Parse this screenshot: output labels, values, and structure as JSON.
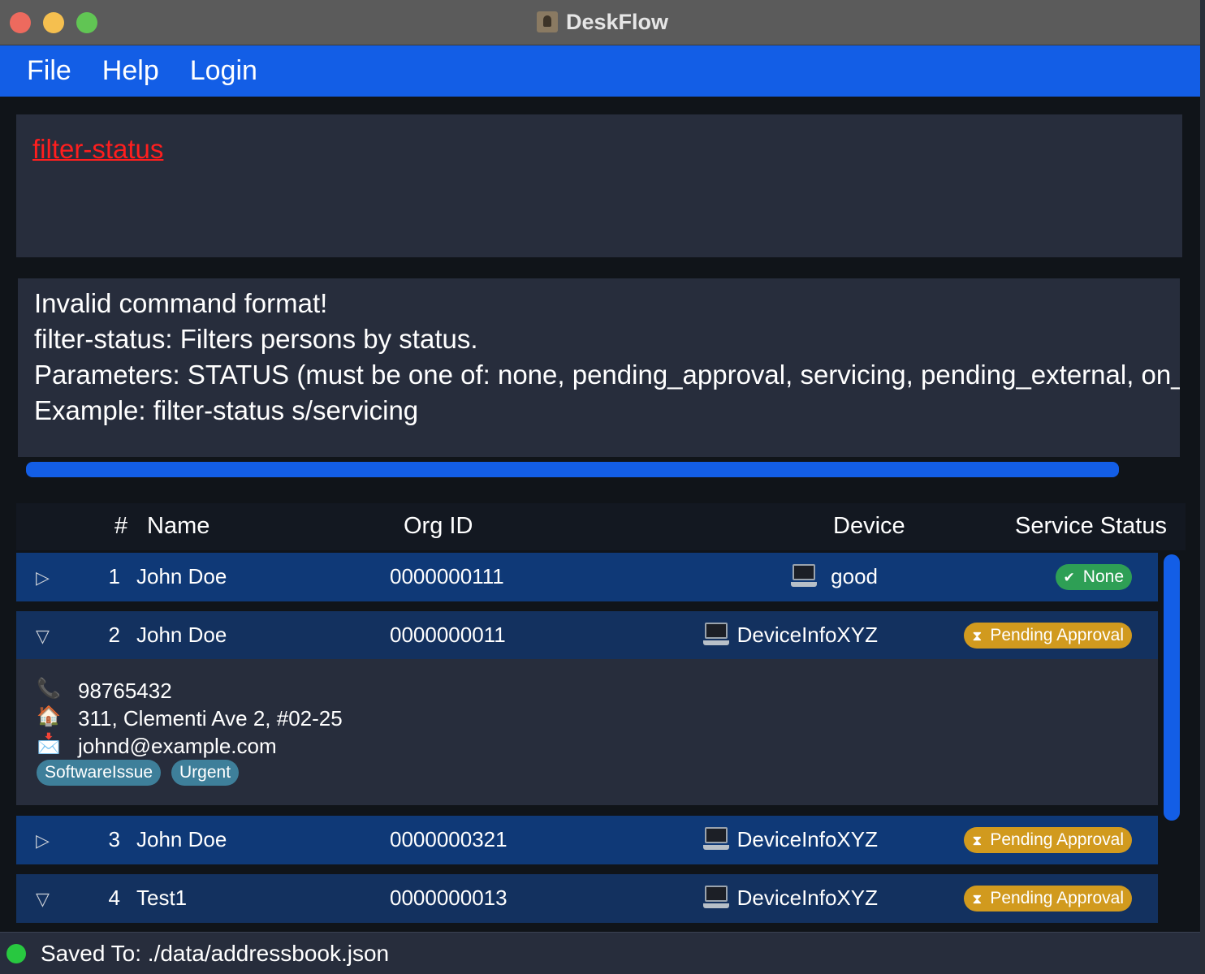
{
  "window": {
    "title": "DeskFlow"
  },
  "menu": {
    "file": "File",
    "help": "Help",
    "login": "Login"
  },
  "command": {
    "value": "filter-status"
  },
  "result": {
    "lines": [
      "Invalid command format!",
      "filter-status: Filters persons by status.",
      "Parameters: STATUS (must be one of: none, pending_approval, servicing, pending_external, on_hold",
      "Example: filter-status s/servicing"
    ]
  },
  "list": {
    "headers": {
      "index": "#",
      "name": "Name",
      "org_id": "Org ID",
      "device": "Device",
      "status": "Service Status"
    },
    "rows": [
      {
        "index": "1",
        "name": "John Doe",
        "org_id": "0000000111",
        "device": "good",
        "status": "None",
        "expanded": false
      },
      {
        "index": "2",
        "name": "John Doe",
        "org_id": "0000000011",
        "device": "DeviceInfoXYZ",
        "status": "Pending Approval",
        "expanded": true
      },
      {
        "index": "3",
        "name": "John Doe",
        "org_id": "0000000321",
        "device": "DeviceInfoXYZ",
        "status": "Pending Approval",
        "expanded": false
      },
      {
        "index": "4",
        "name": "Test1",
        "org_id": "0000000013",
        "device": "DeviceInfoXYZ",
        "status": "Pending Approval",
        "expanded": true
      }
    ],
    "details": {
      "phone": "98765432",
      "address": "311, Clementi Ave 2, #02-25",
      "email": "johnd@example.com",
      "tags": [
        "SoftwareIssue",
        "Urgent"
      ]
    }
  },
  "statusbar": {
    "text": "Saved To:  ./data/addressbook.json"
  },
  "colors": {
    "accent": "#135ee6",
    "error": "#ff1e1e",
    "none_status": "#2e9f55",
    "pending_status": "#d19a1e"
  },
  "icons": {
    "phone": "phone-icon",
    "address": "house-icon",
    "email": "inbox-icon",
    "device": "laptop-icon"
  }
}
